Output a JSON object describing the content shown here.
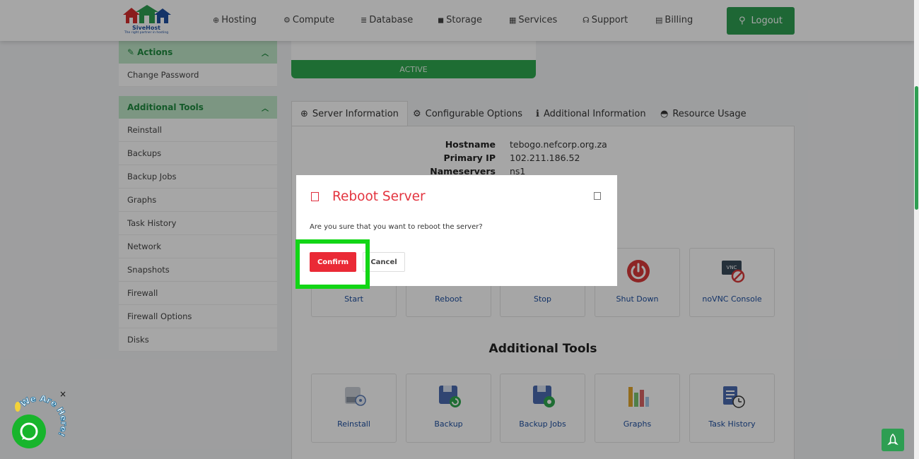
{
  "brand": {
    "name": "SiveHost",
    "tagline": "The right partner in hosting"
  },
  "nav": {
    "items": [
      {
        "label": "Hosting",
        "icon": "globe-icon"
      },
      {
        "label": "Compute",
        "icon": "gear-icon"
      },
      {
        "label": "Database",
        "icon": "database-icon"
      },
      {
        "label": "Storage",
        "icon": "box-icon"
      },
      {
        "label": "Services",
        "icon": "gift-icon"
      },
      {
        "label": "Support",
        "icon": "headset-icon"
      },
      {
        "label": "Billing",
        "icon": "receipt-icon"
      }
    ],
    "logout_label": "Logout"
  },
  "sidebar": {
    "actions": {
      "title": "Actions",
      "items": [
        "Change Password"
      ]
    },
    "tools": {
      "title": "Additional Tools",
      "items": [
        "Reinstall",
        "Backups",
        "Backup Jobs",
        "Graphs",
        "Task History",
        "Network",
        "Snapshots",
        "Firewall",
        "Firewall Options",
        "Disks"
      ]
    }
  },
  "status": {
    "label": "ACTIVE"
  },
  "tabs": [
    {
      "label": "Server Information",
      "icon": "globe-icon"
    },
    {
      "label": "Configurable Options",
      "icon": "cogs-icon"
    },
    {
      "label": "Additional Information",
      "icon": "info-icon"
    },
    {
      "label": "Resource Usage",
      "icon": "hdd-icon"
    }
  ],
  "server_info": {
    "hostname_label": "Hostname",
    "hostname": "tebogo.nefcorp.org.za",
    "ip_label": "Primary IP",
    "ip": "102.211.186.52",
    "ns_label": "Nameservers",
    "ns": "ns1"
  },
  "power_actions": [
    {
      "label": "Start"
    },
    {
      "label": "Reboot"
    },
    {
      "label": "Stop"
    },
    {
      "label": "Shut Down"
    },
    {
      "label": "noVNC Console"
    }
  ],
  "additional_tools": {
    "title": "Additional Tools",
    "items": [
      {
        "label": "Reinstall"
      },
      {
        "label": "Backup"
      },
      {
        "label": "Backup Jobs"
      },
      {
        "label": "Graphs"
      },
      {
        "label": "Task History"
      }
    ]
  },
  "modal": {
    "title": "Reboot Server",
    "message": "Are you sure that you want to reboot the server?",
    "confirm_label": "Confirm",
    "cancel_label": "Cancel"
  },
  "chat": {
    "badge_text": "We Are Here!",
    "close_label": "×"
  },
  "colors": {
    "brand_green": "#2e9e52",
    "danger_red": "#e3343f",
    "link_blue": "#1e4fa0",
    "highlight_green": "#12d616"
  }
}
